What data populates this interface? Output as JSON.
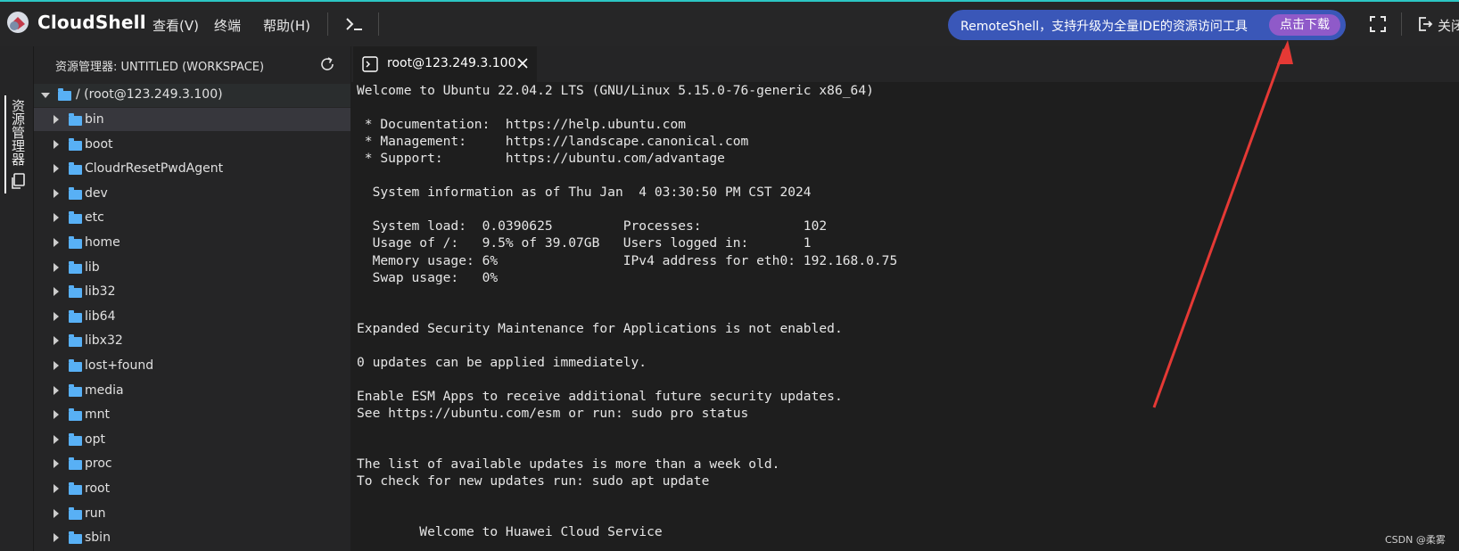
{
  "app": {
    "brand": "CloudShell",
    "logo_icon": "cloudshell-logo-icon"
  },
  "menu": {
    "items": [
      "查看(V)",
      "终端",
      "帮助(H)"
    ]
  },
  "promo": {
    "text": "RemoteShell，支持升级为全量IDE的资源访问工具",
    "button": "点击下载",
    "bg_color": "#3a57b8",
    "button_color": "#8f5ac9"
  },
  "exit": {
    "label": "关闭"
  },
  "activity": {
    "explorer_label": "资源管理器"
  },
  "explorer": {
    "title": "资源管理器: UNTITLED (WORKSPACE)",
    "root": "/ (root@123.249.3.100)",
    "folders": [
      "bin",
      "boot",
      "CloudrResetPwdAgent",
      "dev",
      "etc",
      "home",
      "lib",
      "lib32",
      "lib64",
      "libx32",
      "lost+found",
      "media",
      "mnt",
      "opt",
      "proc",
      "root",
      "run",
      "sbin"
    ]
  },
  "terminal": {
    "tab_label": "root@123.249.3.100",
    "lines": [
      "Welcome to Ubuntu 22.04.2 LTS (GNU/Linux 5.15.0-76-generic x86_64)",
      "",
      " * Documentation:  https://help.ubuntu.com",
      " * Management:     https://landscape.canonical.com",
      " * Support:        https://ubuntu.com/advantage",
      "",
      "  System information as of Thu Jan  4 03:30:50 PM CST 2024",
      "",
      "  System load:  0.0390625         Processes:             102",
      "  Usage of /:   9.5% of 39.07GB   Users logged in:       1",
      "  Memory usage: 6%                IPv4 address for eth0: 192.168.0.75",
      "  Swap usage:   0%",
      "",
      "",
      "Expanded Security Maintenance for Applications is not enabled.",
      "",
      "0 updates can be applied immediately.",
      "",
      "Enable ESM Apps to receive additional future security updates.",
      "See https://ubuntu.com/esm or run: sudo pro status",
      "",
      "",
      "The list of available updates is more than a week old.",
      "To check for new updates run: sudo apt update",
      "",
      "",
      "        Welcome to Huawei Cloud Service"
    ]
  },
  "annotation": {
    "arrow_color": "#e53935"
  },
  "watermark": "CSDN @柔雾"
}
